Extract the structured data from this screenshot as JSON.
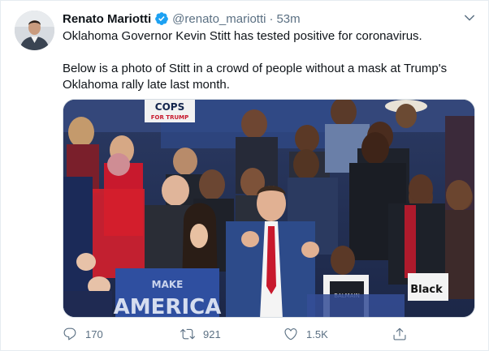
{
  "tweet": {
    "author": {
      "name": "Renato Mariotti",
      "handle": "@renato_mariotti",
      "verified": true
    },
    "separator": "·",
    "time": "53m",
    "text_paragraphs": [
      "Oklahoma Governor Kevin Stitt has tested positive for coronavirus.",
      "Below is a photo of Stitt in a crowd of people without a mask at Trump's Oklahoma rally late last month."
    ],
    "media": {
      "signs": {
        "cops": "COPS",
        "cops_sub": "FOR TRUMP",
        "make": "MAKE",
        "america": "AMERICA",
        "balmain": "BALMAIN",
        "black": "Black"
      }
    },
    "actions": {
      "replies": "170",
      "retweets": "921",
      "likes": "1.5K"
    }
  },
  "icons": {
    "verified": "verified-badge-icon",
    "caret": "chevron-down-icon",
    "reply": "reply-icon",
    "retweet": "retweet-icon",
    "like": "heart-icon",
    "share": "share-icon"
  },
  "colors": {
    "verified": "#1da1f2",
    "secondary_text": "#5b7083",
    "primary_text": "#0f1419",
    "border": "#e6ecf0"
  }
}
